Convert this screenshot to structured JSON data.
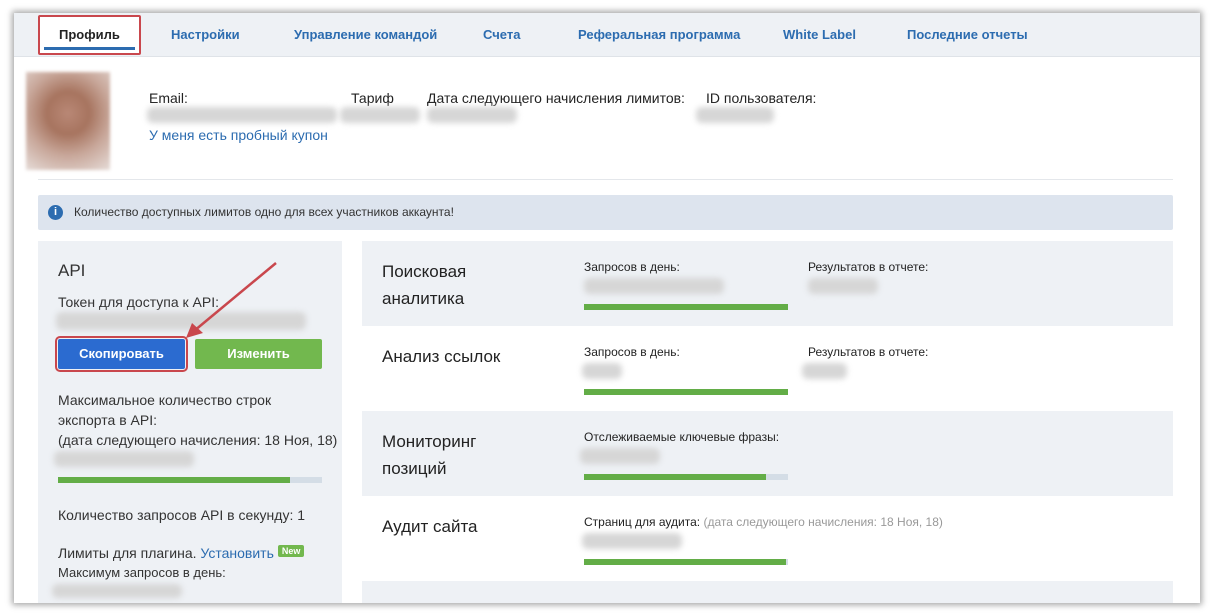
{
  "tabs": [
    {
      "label": "Профиль"
    },
    {
      "label": "Настройки"
    },
    {
      "label": "Управление командой"
    },
    {
      "label": "Счета"
    },
    {
      "label": "Реферальная программа"
    },
    {
      "label": "White Label"
    },
    {
      "label": "Последние отчеты"
    }
  ],
  "profile": {
    "email_label": "Email:",
    "tariff_label": "Тариф",
    "next_limits_label": "Дата следующего начисления лимитов:",
    "user_id_label": "ID пользователя:",
    "coupon_link": "У меня есть пробный купон"
  },
  "alert": {
    "icon": "info-icon",
    "text": "Количество доступных лимитов одно для всех участников аккаунта!"
  },
  "api": {
    "title": "API",
    "token_label": "Токен для доступа к API:",
    "copy_button": "Скопировать",
    "edit_button": "Изменить",
    "max_rows_label_1": "Максимальное количество строк",
    "max_rows_label_2": "экспорта в API:",
    "next_accrual": "(дата следующего начисления: 18 Ноя, 18)",
    "max_rows_progress": 0.88,
    "rps_label": "Количество запросов API в секунду: 1",
    "plugin_limits_label": "Лимиты для плагина.",
    "install_link": "Установить",
    "new_badge": "New",
    "max_requests_label": "Максимум запросов в день:"
  },
  "cards": [
    {
      "title_1": "Поисковая",
      "title_2": "аналитика",
      "label_a": "Запросов в день:",
      "label_b": "Результатов в отчете:",
      "progress": 1.0
    },
    {
      "title_1": "Анализ ссылок",
      "label_a": "Запросов в день:",
      "label_b": "Результатов в отчете:",
      "progress": 1.0
    },
    {
      "title_1": "Мониторинг",
      "title_2": "позиций",
      "label_a": "Отслеживаемые ключевые фразы:",
      "progress": 0.89
    },
    {
      "title_1": "Аудит сайта",
      "label_a": "Страниц для аудита:",
      "label_a_note": "(дата следующего начисления: 18 Ноя, 18)",
      "progress": 0.99
    }
  ],
  "colors": {
    "accent": "#2c6cb0",
    "copy_button": "#2b6bd0",
    "edit_button": "#72b84e",
    "progress_fill": "#63ad47",
    "highlight": "#c9474d"
  }
}
